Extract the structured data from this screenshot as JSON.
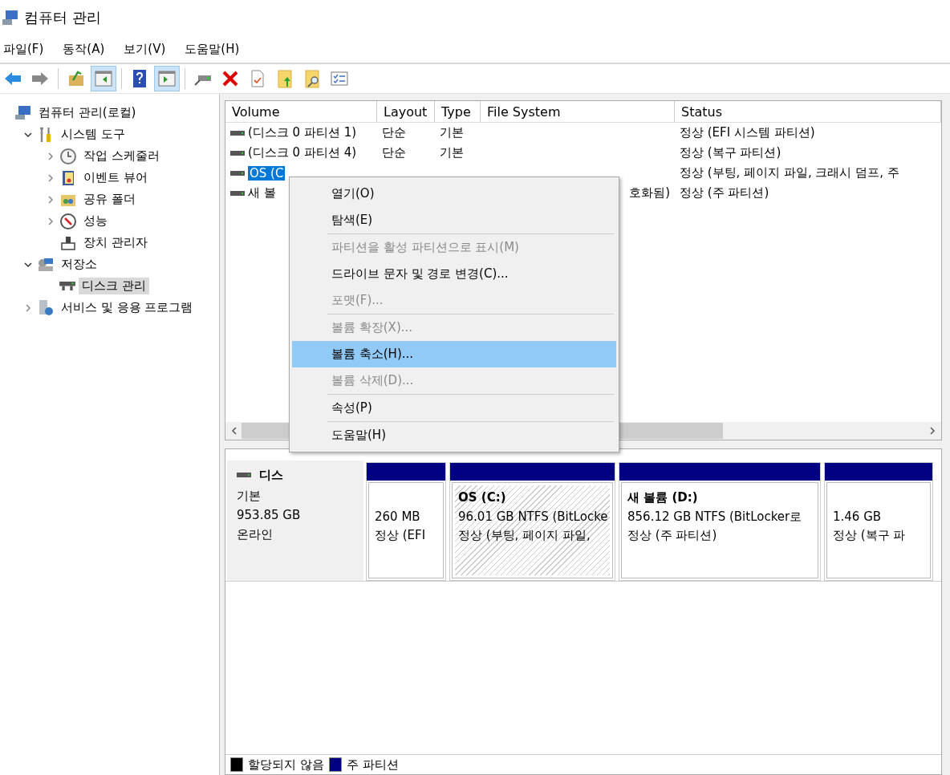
{
  "window": {
    "title": "컴퓨터 관리"
  },
  "menu": [
    "파일(F)",
    "동작(A)",
    "보기(V)",
    "도움말(H)"
  ],
  "toolbar": [
    [
      {
        "kind": "back",
        "selected": false
      },
      {
        "kind": "forward",
        "selected": false
      }
    ],
    [
      {
        "kind": "up-folder",
        "selected": false
      },
      {
        "kind": "tree-pane",
        "selected": true
      }
    ],
    [
      {
        "kind": "help",
        "selected": false
      },
      {
        "kind": "action-pane",
        "selected": true
      }
    ],
    [
      {
        "kind": "drive",
        "selected": false
      },
      {
        "kind": "delete",
        "selected": false
      },
      {
        "kind": "check-doc",
        "selected": false
      },
      {
        "kind": "folder-up",
        "selected": false
      },
      {
        "kind": "folder-search",
        "selected": false
      },
      {
        "kind": "list",
        "selected": false
      }
    ]
  ],
  "tree": [
    {
      "label": "컴퓨터 관리(로컬)",
      "kind": "computer",
      "selected": false,
      "children": [
        {
          "label": "시스템 도구",
          "kind": "tools",
          "expanded": true,
          "selected": false,
          "children": [
            {
              "label": "작업 스케줄러",
              "kind": "clock",
              "expanded": false,
              "selected": false
            },
            {
              "label": "이벤트 뷰어",
              "kind": "event",
              "expanded": false,
              "selected": false
            },
            {
              "label": "공유 폴더",
              "kind": "shared",
              "expanded": false,
              "selected": false
            },
            {
              "label": "성능",
              "kind": "perf",
              "expanded": false,
              "selected": false
            },
            {
              "label": "장치 관리자",
              "kind": "device",
              "selected": false
            }
          ]
        },
        {
          "label": "저장소",
          "kind": "storage",
          "expanded": true,
          "selected": false,
          "children": [
            {
              "label": "디스크 관리",
              "kind": "disk",
              "selected": true
            }
          ]
        },
        {
          "label": "서비스 및 응용 프로그램",
          "kind": "services",
          "expanded": false,
          "selected": false
        }
      ]
    }
  ],
  "table": {
    "columns": [
      "Volume",
      "Layout",
      "Type",
      "File System",
      "Status"
    ],
    "rows": [
      {
        "volume": "(디스크 0 파티션 1)",
        "layout": "단순",
        "type": "기본",
        "status": "정상 (EFI 시스템 파티션)",
        "selected": false
      },
      {
        "volume": "(디스크 0 파티션 4)",
        "layout": "단순",
        "type": "기본",
        "status": "정상 (복구 파티션)",
        "selected": false
      },
      {
        "volume": "OS (C",
        "status": "정상 (부팅, 페이지 파일, 크래시 덤프, 주",
        "selected": true
      },
      {
        "volume": "새 볼",
        "file_system": "호화됨)",
        "status": "정상 (주 파티션)",
        "selected": false
      }
    ]
  },
  "context_menu": [
    {
      "kind": "item",
      "label": "열기(O)",
      "disabled": false,
      "selected": false
    },
    {
      "kind": "item",
      "label": "탐색(E)",
      "disabled": false,
      "selected": false
    },
    {
      "kind": "separator"
    },
    {
      "kind": "item",
      "label": "파티션을 활성 파티션으로 표시(M)",
      "disabled": true,
      "selected": false
    },
    {
      "kind": "item",
      "label": "드라이브 문자 및 경로 변경(C)...",
      "disabled": false,
      "selected": false
    },
    {
      "kind": "item",
      "label": "포맷(F)...",
      "disabled": true,
      "selected": false
    },
    {
      "kind": "separator"
    },
    {
      "kind": "item",
      "label": "볼륨 확장(X)...",
      "disabled": true,
      "selected": false
    },
    {
      "kind": "item",
      "label": "볼륨 축소(H)...",
      "disabled": false,
      "selected": true
    },
    {
      "kind": "item",
      "label": "볼륨 삭제(D)...",
      "disabled": true,
      "selected": false
    },
    {
      "kind": "separator"
    },
    {
      "kind": "item",
      "label": "속성(P)",
      "disabled": false,
      "selected": false
    },
    {
      "kind": "separator"
    },
    {
      "kind": "item",
      "label": "도움말(H)",
      "disabled": false,
      "selected": false
    }
  ],
  "disk": {
    "name": "디스",
    "lines": [
      "기본",
      "953.85 GB",
      "온라인"
    ],
    "partitions": [
      {
        "lines": [
          "260 MB",
          "정상 (EFI"
        ],
        "selected": false
      },
      {
        "title": "OS  (C:)",
        "lines": [
          "96.01 GB NTFS (BitLocke",
          "정상 (부팅, 페이지 파일,"
        ],
        "selected": true
      },
      {
        "title": "새 볼륨  (D:)",
        "lines": [
          "856.12 GB NTFS (BitLocker로",
          "정상 (주 파티션)"
        ],
        "selected": false
      },
      {
        "lines": [
          "1.46 GB",
          "정상 (복구 파"
        ],
        "selected": false
      }
    ]
  },
  "legend": [
    {
      "label": "할당되지 않음",
      "color": "#000000"
    },
    {
      "label": "주 파티션",
      "color": "#000080"
    }
  ]
}
